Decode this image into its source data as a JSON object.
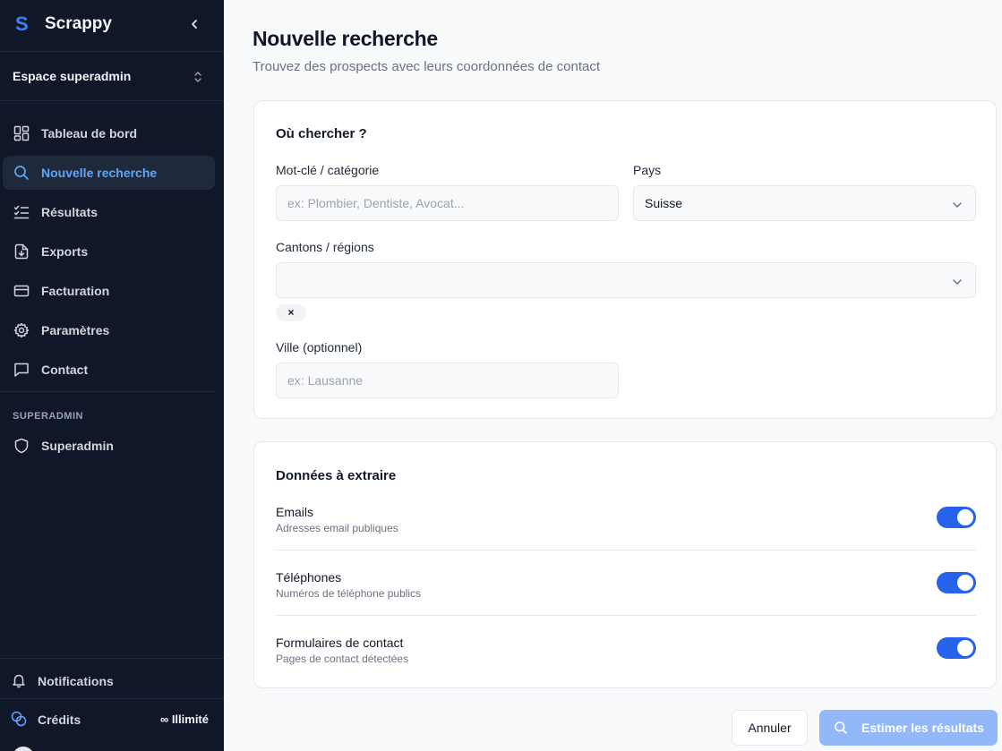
{
  "sidebar": {
    "brand": {
      "logo": "S",
      "name": "Scrappy"
    },
    "workspace": "Espace superadmin",
    "items": [
      {
        "label": "Tableau de bord",
        "icon": "dashboard-icon",
        "active": false
      },
      {
        "label": "Nouvelle recherche",
        "icon": "search-icon",
        "active": true
      },
      {
        "label": "Résultats",
        "icon": "list-check-icon",
        "active": false
      },
      {
        "label": "Exports",
        "icon": "file-download-icon",
        "active": false
      },
      {
        "label": "Facturation",
        "icon": "credit-card-icon",
        "active": false
      },
      {
        "label": "Paramètres",
        "icon": "gear-icon",
        "active": false
      },
      {
        "label": "Contact",
        "icon": "message-icon",
        "active": false
      }
    ],
    "section_label": "SUPERADMIN",
    "superadmin_label": "Superadmin",
    "notifications_label": "Notifications",
    "credits_label": "Crédits",
    "credits_value": "∞ Illimité"
  },
  "main": {
    "title": "Nouvelle recherche",
    "subtitle": "Trouvez des prospects avec leurs coordonnées de contact",
    "where": {
      "title": "Où chercher ?",
      "keyword_label": "Mot-clé / catégorie",
      "keyword_placeholder": "ex: Plombier, Dentiste, Avocat...",
      "country_label": "Pays",
      "country_value": "Suisse",
      "regions_label": "Cantons / régions",
      "chip_label": "×",
      "city_label": "Ville (optionnel)",
      "city_placeholder": "ex: Lausanne"
    },
    "extract": {
      "title": "Données à extraire",
      "options": [
        {
          "title": "Emails",
          "description": "Adresses email publiques",
          "enabled": true
        },
        {
          "title": "Téléphones",
          "description": "Numéros de téléphone publics",
          "enabled": true
        },
        {
          "title": "Formulaires de contact",
          "description": "Pages de contact détectées",
          "enabled": true
        }
      ]
    },
    "actions": {
      "cancel": "Annuler",
      "estimate": "Estimer les résultats"
    }
  },
  "colors": {
    "sidebar_bg": "#0f1729",
    "accent": "#2563eb",
    "active_text": "#60a5fa",
    "estimate_button": "#93b8f7"
  }
}
